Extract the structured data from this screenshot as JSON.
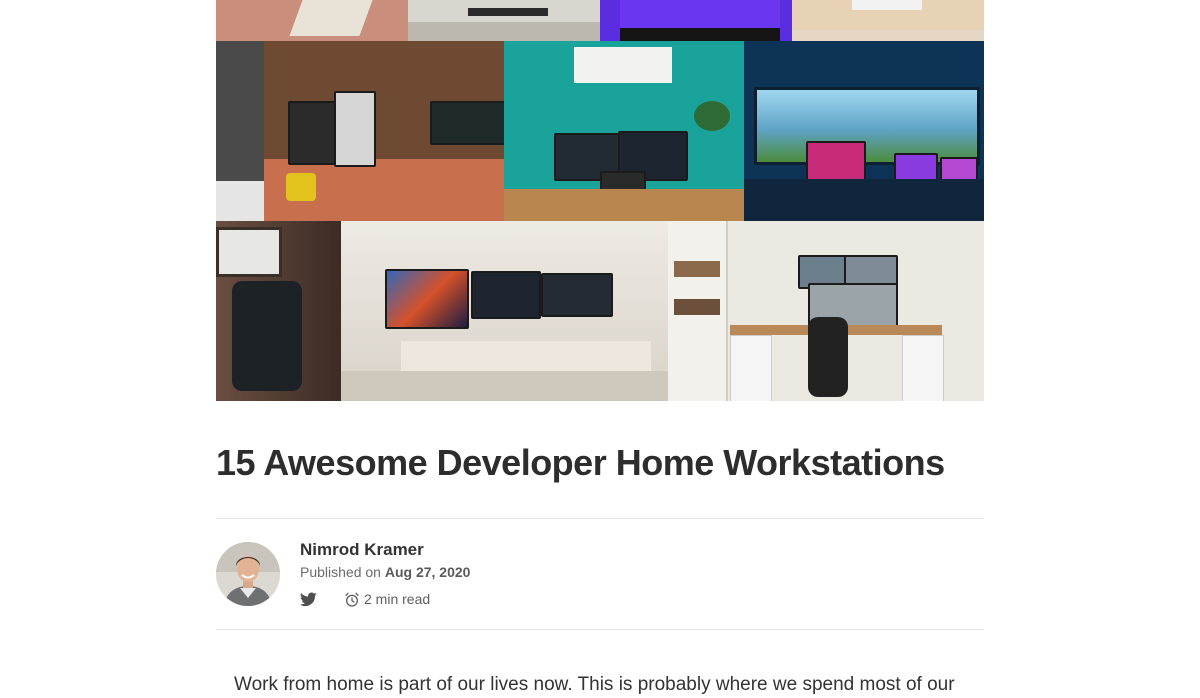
{
  "article": {
    "title": "15 Awesome Developer Home Workstations",
    "intro": "Work from home is part of our lives now. This is probably where we spend most of our"
  },
  "author": {
    "name": "Nimrod Kramer",
    "published_prefix": "Published on",
    "published_date": "Aug 27, 2020",
    "read_time": "2 min read"
  },
  "icons": {
    "twitter": "twitter-icon",
    "clock": "alarm-clock-icon"
  },
  "colors": {
    "title": "#2d2d2d",
    "meta": "#6b6b6b",
    "divider": "#e6e6e6"
  }
}
